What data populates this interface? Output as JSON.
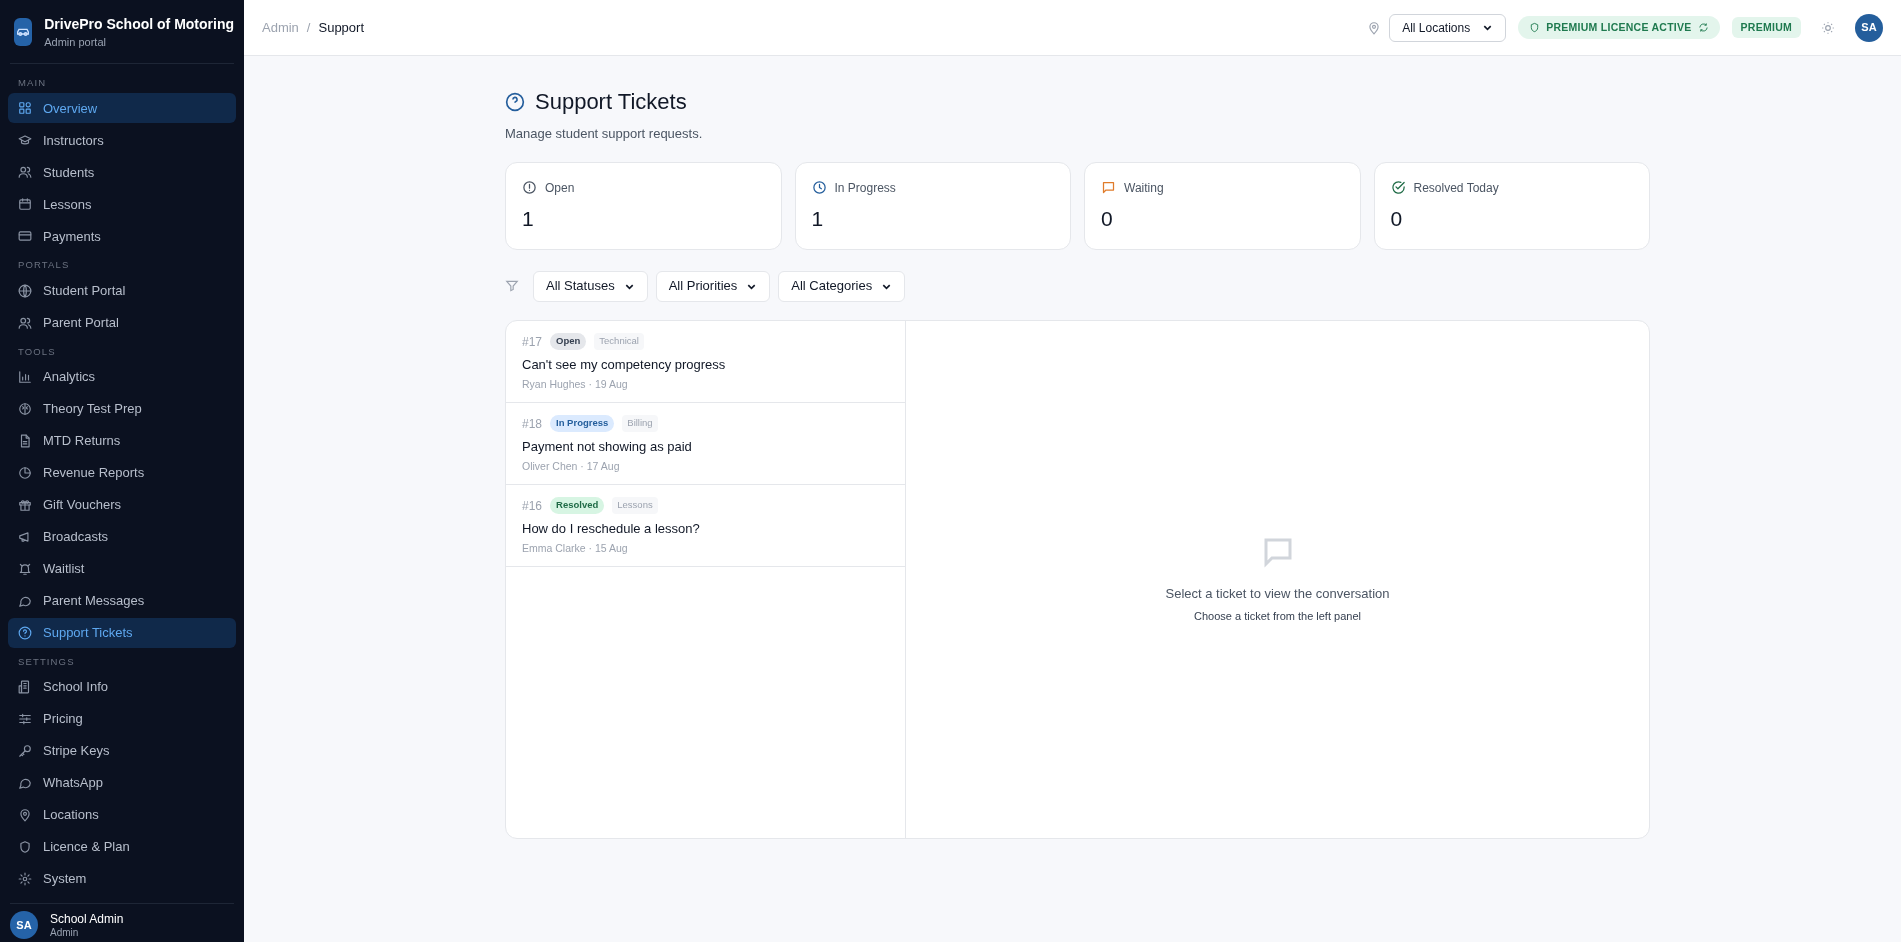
{
  "brand": {
    "name": "DrivePro School of Motoring",
    "subtitle": "Admin portal"
  },
  "sidebar": {
    "sections": [
      {
        "title": "MAIN",
        "items": [
          {
            "label": "Overview",
            "selected": true
          },
          {
            "label": "Instructors",
            "selected": false
          },
          {
            "label": "Students",
            "selected": false
          },
          {
            "label": "Lessons",
            "selected": false
          },
          {
            "label": "Payments",
            "selected": false
          }
        ]
      },
      {
        "title": "PORTALS",
        "items": [
          {
            "label": "Student Portal",
            "selected": false
          },
          {
            "label": "Parent Portal",
            "selected": false
          }
        ]
      },
      {
        "title": "TOOLS",
        "items": [
          {
            "label": "Analytics",
            "selected": false
          },
          {
            "label": "Theory Test Prep",
            "selected": false
          },
          {
            "label": "MTD Returns",
            "selected": false
          },
          {
            "label": "Revenue Reports",
            "selected": false
          },
          {
            "label": "Gift Vouchers",
            "selected": false
          },
          {
            "label": "Broadcasts",
            "selected": false
          },
          {
            "label": "Waitlist",
            "selected": false
          },
          {
            "label": "Parent Messages",
            "selected": false
          },
          {
            "label": "Support Tickets",
            "selected": true
          }
        ]
      },
      {
        "title": "SETTINGS",
        "items": [
          {
            "label": "School Info",
            "selected": false
          },
          {
            "label": "Pricing",
            "selected": false
          },
          {
            "label": "Stripe Keys",
            "selected": false
          },
          {
            "label": "WhatsApp",
            "selected": false
          },
          {
            "label": "Locations",
            "selected": false
          },
          {
            "label": "Licence & Plan",
            "selected": false
          },
          {
            "label": "System",
            "selected": false
          }
        ]
      }
    ],
    "user": {
      "initials": "SA",
      "name": "School Admin",
      "role": "Admin"
    }
  },
  "header": {
    "breadcrumb": [
      "Admin",
      "Support"
    ],
    "breadcrumb_separator": "/",
    "location_select": "All Locations",
    "licence_badge": "PREMIUM LICENCE ACTIVE",
    "plan_badge": "PREMIUM",
    "avatar": "SA"
  },
  "page": {
    "title": "Support Tickets",
    "subtitle": "Manage student support requests."
  },
  "stats": [
    {
      "kind": "open",
      "label": "Open",
      "value": "1"
    },
    {
      "kind": "progress",
      "label": "In Progress",
      "value": "1"
    },
    {
      "kind": "waiting",
      "label": "Waiting",
      "value": "0"
    },
    {
      "kind": "resolved",
      "label": "Resolved Today",
      "value": "0"
    }
  ],
  "filters": [
    "All Statuses",
    "All Priorities",
    "All Categories"
  ],
  "tickets": [
    {
      "number": "#17",
      "status": "Open",
      "kind": "open",
      "category": "Technical",
      "subject": "Can't see my competency progress",
      "meta": "Ryan Hughes · 19 Aug"
    },
    {
      "number": "#18",
      "status": "In Progress",
      "kind": "progress",
      "category": "Billing",
      "subject": "Payment not showing as paid",
      "meta": "Oliver Chen · 17 Aug"
    },
    {
      "number": "#16",
      "status": "Resolved",
      "kind": "resolved",
      "category": "Lessons",
      "subject": "How do I reschedule a lesson?",
      "meta": "Emma Clarke · 15 Aug"
    }
  ],
  "empty_state": {
    "title": "Select a ticket to view the conversation",
    "hint": "Choose a ticket from the left panel"
  }
}
